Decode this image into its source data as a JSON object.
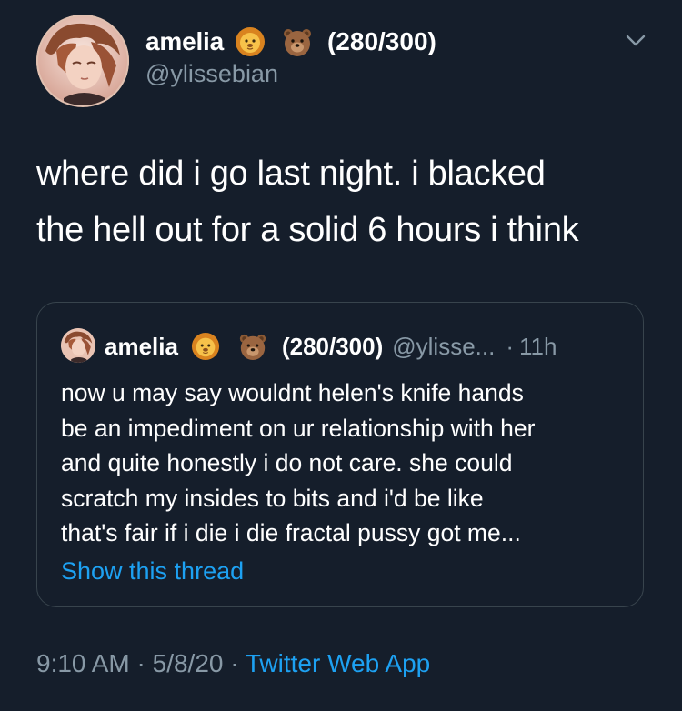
{
  "tweet": {
    "author": {
      "display_name": "amelia",
      "emojis": [
        "lion-face-icon",
        "bear-face-icon"
      ],
      "name_suffix": "(280/300)",
      "handle": "@ylissebian"
    },
    "text_lines": [
      "where did i go last night. i blacked",
      "the hell out for a solid 6 hours i think"
    ],
    "quoted": {
      "display_name": "amelia",
      "name_suffix": "(280/300)",
      "handle": "@ylisse...",
      "separator": "·",
      "time": "11h",
      "text_lines": [
        "now u may say wouldnt helen's knife hands",
        "be an impediment on ur relationship with her",
        "and quite honestly i do not care. she could",
        "scratch my insides to bits and i'd be like",
        "that's fair if i die i die fractal pussy got me..."
      ],
      "show_thread": "Show this thread"
    },
    "meta": {
      "time": "9:10 AM",
      "sep1": "·",
      "date": "5/8/20",
      "sep2": "·",
      "app": "Twitter Web App"
    }
  },
  "colors": {
    "background": "#151e2b",
    "text": "#ffffff",
    "secondary": "#8899a6",
    "link": "#1da1f2",
    "border": "#38444d"
  }
}
